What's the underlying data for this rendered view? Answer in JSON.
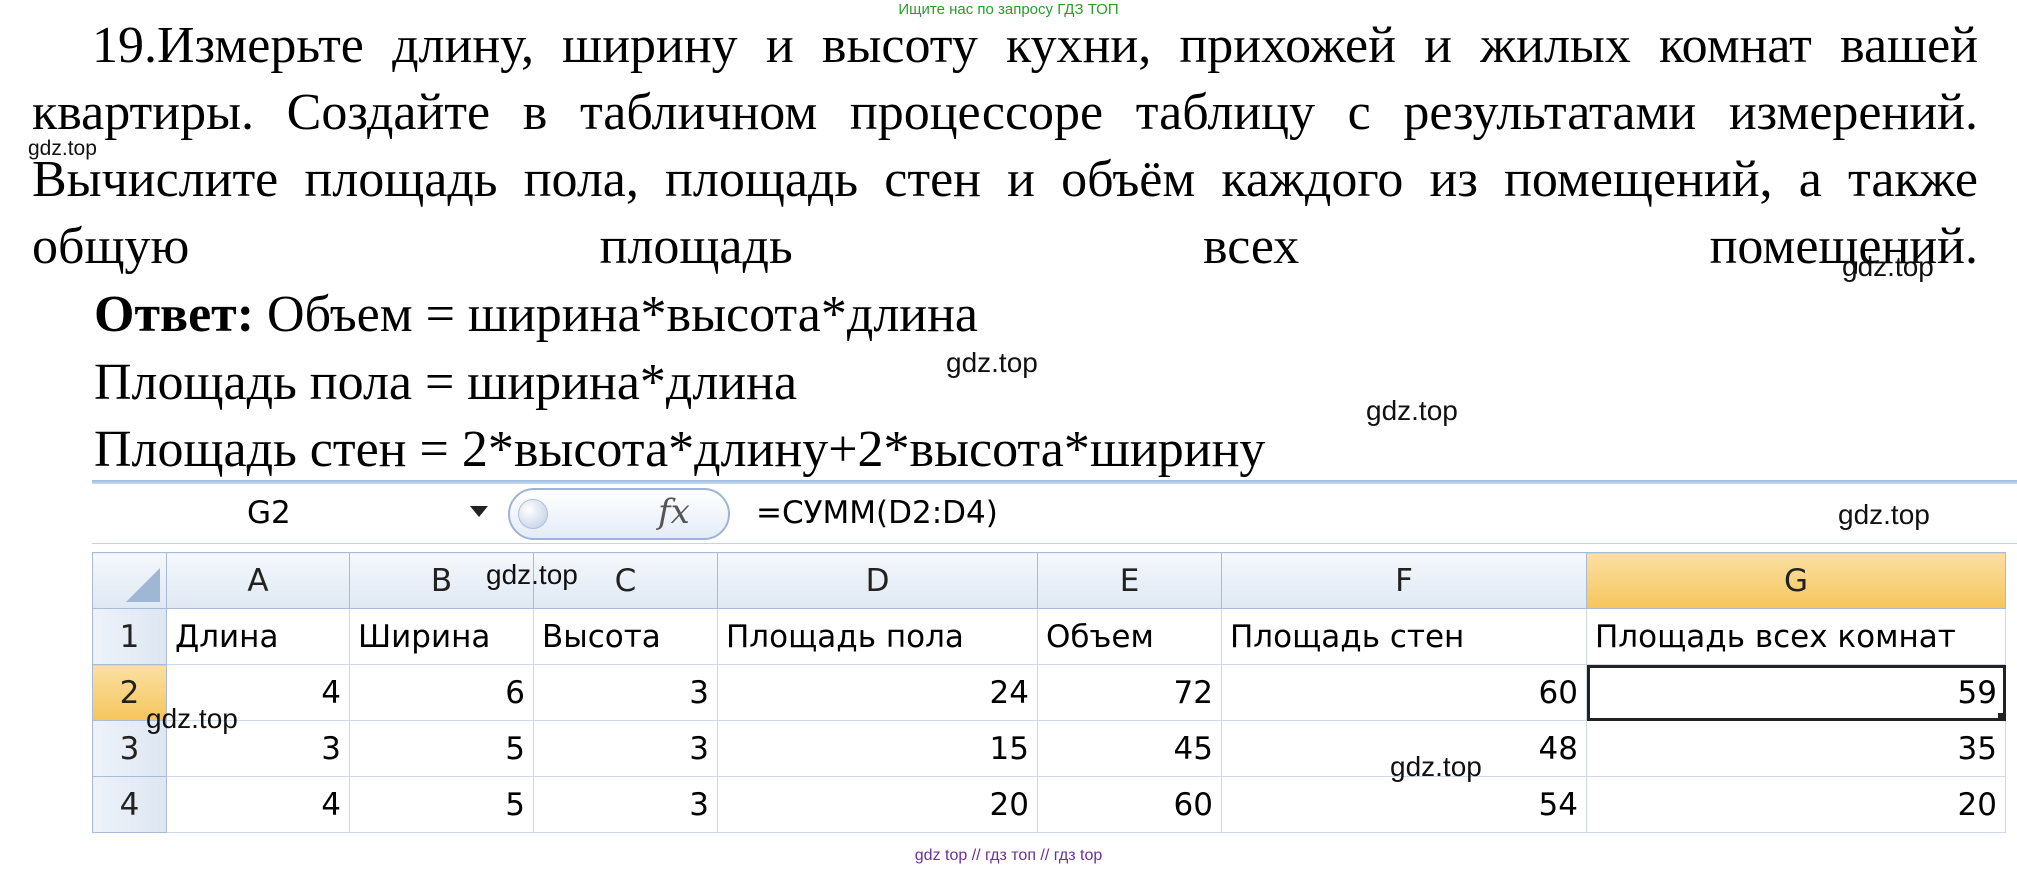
{
  "banner": "Ищите нас по запросу ГДЗ ТОП",
  "task": "19.Измерьте длину, ширину и высоту кухни, прихожей и жилых комнат вашей квартиры. Создайте в табличном процессоре таблицу с результатами измерений. Вычислите площадь пола, площадь стен и объём каждого из помещений, а также общую площадь всех помещений.",
  "answer": {
    "label": "Ответ:",
    "line1": " Объем = ширина*высота*длина",
    "line2": "Площадь пола = ширина*длина",
    "line3": "Площадь стен = 2*высота*длину+2*высота*ширину"
  },
  "watermark": "gdz.top",
  "excel": {
    "name_box": "G2",
    "fx": "fx",
    "formula": "=СУММ(D2:D4)",
    "columns": [
      "A",
      "B",
      "C",
      "D",
      "E",
      "F",
      "G"
    ],
    "header_row": {
      "num": "1",
      "cells": [
        "Длина",
        "Ширина",
        "Высота",
        "Площадь пола",
        "Объем",
        "Площадь стен",
        "Площадь всех комнат"
      ]
    },
    "rows": [
      {
        "num": "2",
        "cells": [
          "4",
          "6",
          "3",
          "24",
          "72",
          "60",
          "59"
        ]
      },
      {
        "num": "3",
        "cells": [
          "3",
          "5",
          "3",
          "15",
          "45",
          "48",
          "35"
        ]
      },
      {
        "num": "4",
        "cells": [
          "4",
          "5",
          "3",
          "20",
          "60",
          "54",
          "20"
        ]
      }
    ]
  },
  "footer": "gdz top  //  гдз топ  //  гдз top"
}
